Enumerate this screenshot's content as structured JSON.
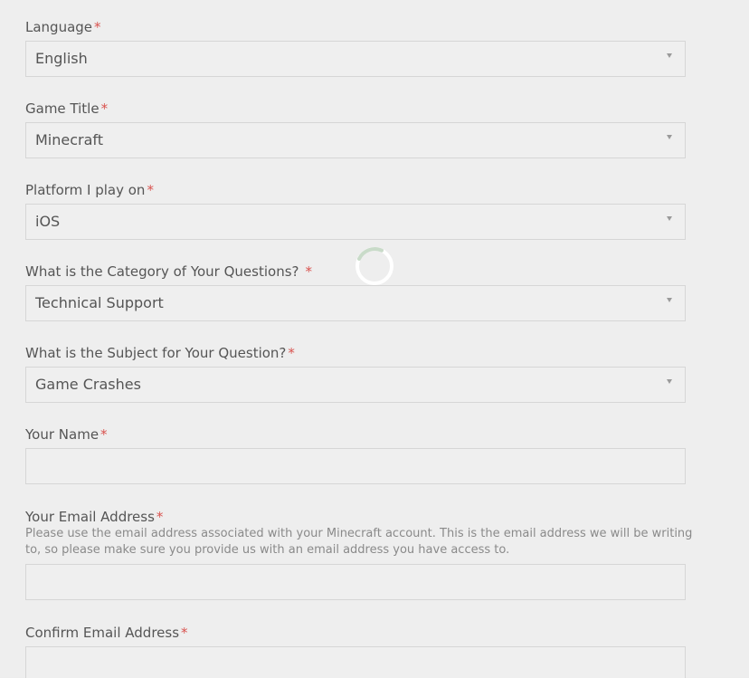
{
  "form": {
    "language": {
      "label": "Language",
      "required_mark": "*",
      "value": "English"
    },
    "game_title": {
      "label": "Game Title",
      "required_mark": "*",
      "value": "Minecraft"
    },
    "platform": {
      "label": "Platform I play on",
      "required_mark": "*",
      "value": "iOS"
    },
    "category": {
      "label": "What is the Category of Your Questions?",
      "required_mark": "*",
      "value": "Technical Support"
    },
    "subject": {
      "label": "What is the Subject for Your Question?",
      "required_mark": "*",
      "value": "Game Crashes"
    },
    "name": {
      "label": "Your Name",
      "required_mark": "*",
      "value": ""
    },
    "email": {
      "label": "Your Email Address",
      "required_mark": "*",
      "help": "Please use the email address associated with your Minecraft account. This is the email address we will be writing to, so please make sure you provide us with an email address you have access to.",
      "value": ""
    },
    "confirm_email": {
      "label": "Confirm Email Address",
      "required_mark": "*",
      "value": ""
    }
  },
  "colors": {
    "required": "#d9534f",
    "spinner": "#c9dbc9"
  },
  "icons": {
    "select_caret": "chevron-down-icon",
    "loading": "loading-spinner-icon"
  }
}
